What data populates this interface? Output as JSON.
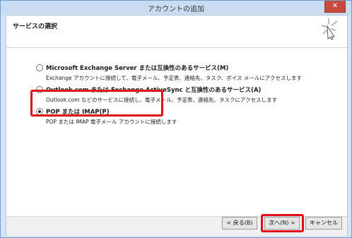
{
  "window": {
    "title": "アカウントの追加",
    "close_glyph": "✕"
  },
  "header": {
    "heading": "サービスの選択",
    "icon": "sparkle-icon"
  },
  "options": [
    {
      "label": "Microsoft Exchange Server または互換性のあるサービス(M)",
      "description": "Exchange アカウントに接続して、電子メール、予定表、連絡先、タスク、ボイス メールにアクセスします",
      "selected": false
    },
    {
      "label": "Outlook.com または Exchange ActiveSync と互換性のあるサービス(A)",
      "description": "Outlook.com などのサービスに接続し、電子メール、予定表、連絡先、タスクにアクセスします",
      "selected": false
    },
    {
      "label": "POP または IMAP(P)",
      "description": "POP または IMAP 電子メール アカウントに接続します",
      "selected": true
    }
  ],
  "buttons": {
    "back": "< 戻る(B)",
    "next": "次へ(N) >",
    "cancel": "キャンセル"
  },
  "colors": {
    "highlight": "#e0101a",
    "close_button": "#c74b3e",
    "titlebar": "#c9dcf2"
  }
}
